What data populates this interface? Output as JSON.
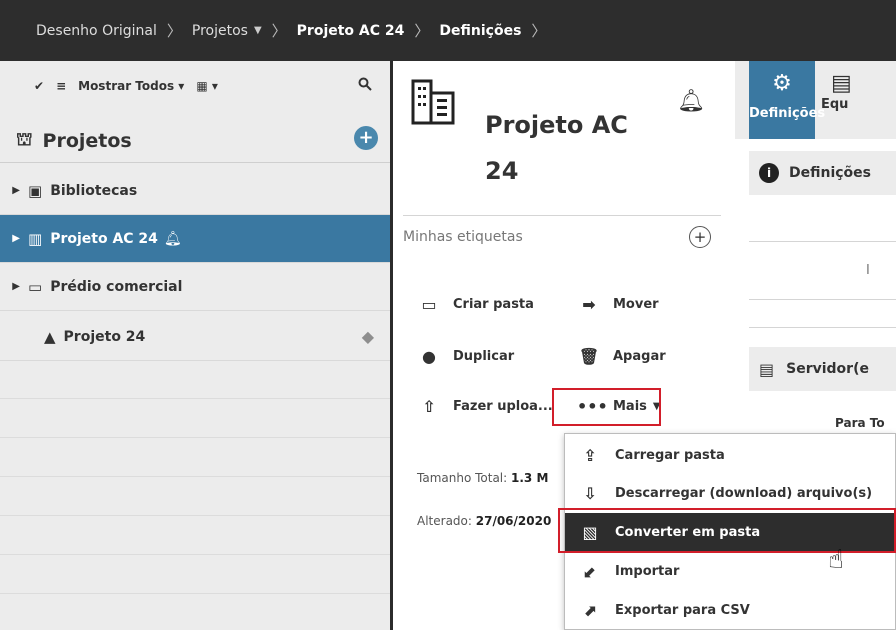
{
  "breadcrumb": {
    "items": [
      "Desenho Original",
      "Projetos",
      "Projeto AC 24",
      "Definições"
    ],
    "separator": ">"
  },
  "left_panel": {
    "toolbar": {
      "filter_label": "Mostrar Todos"
    },
    "header_title": "Projetos",
    "add_button": "+",
    "tree": [
      {
        "label": "Bibliotecas",
        "icon": "library-icon",
        "expandable": true,
        "selected": false
      },
      {
        "label": "Projeto AC 24",
        "icon": "building-icon",
        "expandable": true,
        "selected": true,
        "bell": true
      },
      {
        "label": "Prédio comercial",
        "icon": "folder-icon",
        "expandable": true,
        "selected": false
      },
      {
        "label": "Projeto 24",
        "icon": "project-icon",
        "expandable": false,
        "selected": false,
        "tag": true
      }
    ]
  },
  "middle_panel": {
    "title_line1": "Projeto AC",
    "title_line2": "24",
    "tags_label": "Minhas etiquetas",
    "tags_add": "+",
    "actions": {
      "create_folder": "Criar pasta",
      "move": "Mover",
      "duplicate": "Duplicar",
      "delete": "Apagar",
      "upload": "Fazer uploa...",
      "more": "Mais"
    },
    "info": {
      "size_label": "Tamanho Total:",
      "size_value": "1.3 M",
      "changed_label": "Alterado:",
      "changed_value": "27/06/2020"
    }
  },
  "right_panel": {
    "tabs": [
      "Definições",
      "Equ"
    ],
    "section1_title": "Definições",
    "faint_letter": "I",
    "section2_title": "Servidor(e",
    "para_label": "Para To"
  },
  "dropdown_menu": {
    "items": [
      {
        "label": "Carregar pasta",
        "icon": "upload-folder-icon",
        "highlighted": false
      },
      {
        "label": "Descarregar (download) arquivo(s)",
        "icon": "download-icon",
        "highlighted": false
      },
      {
        "label": "Converter em pasta",
        "icon": "convert-icon",
        "highlighted": true
      },
      {
        "label": "Importar",
        "icon": "import-icon",
        "highlighted": false
      },
      {
        "label": "Exportar para CSV",
        "icon": "export-icon",
        "highlighted": false
      }
    ]
  },
  "colors": {
    "topbar": "#2d2d2d",
    "selected_row": "#3a78a1",
    "highlight_border": "#d21e2a",
    "panel_gray": "#ececec"
  }
}
